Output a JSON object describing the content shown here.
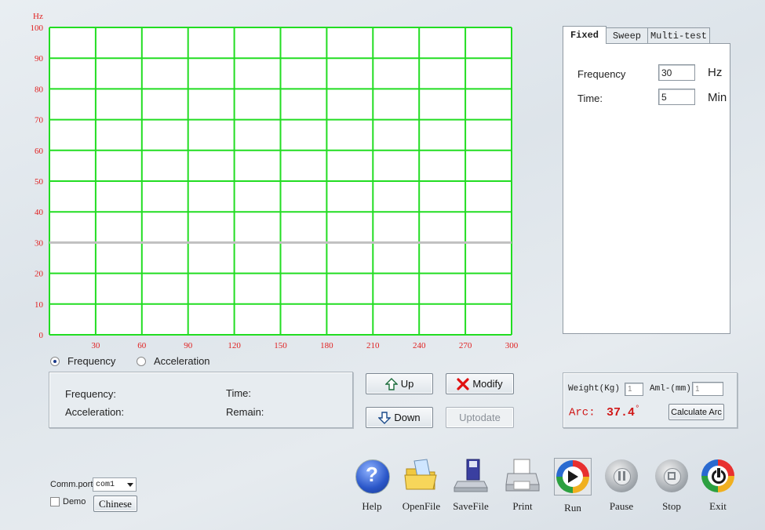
{
  "chart_data": {
    "type": "line",
    "y_unit": "Hz",
    "ylim": [
      0,
      100
    ],
    "xlim": [
      0,
      300
    ],
    "y_ticks": [
      0,
      10,
      20,
      30,
      40,
      50,
      60,
      70,
      80,
      90,
      100
    ],
    "x_ticks": [
      30,
      60,
      90,
      120,
      150,
      180,
      210,
      240,
      270,
      300
    ],
    "grid": true,
    "grid_color": "#22dd22",
    "series": [
      {
        "x": [
          0,
          300
        ],
        "y": [
          30,
          30
        ],
        "color": "#c0c0c0"
      }
    ]
  },
  "mode": {
    "frequency_label": "Frequency",
    "acceleration_label": "Acceleration",
    "selected": "Frequency"
  },
  "status": {
    "frequency_label": "Frequency:",
    "acceleration_label": "Acceleration:",
    "time_label": "Time:",
    "remain_label": "Remain:"
  },
  "buttons": {
    "up": "Up",
    "down": "Down",
    "modify": "Modify",
    "uptodate": "Uptodate"
  },
  "tabs": [
    {
      "label": "Fixed"
    },
    {
      "label": "Sweep"
    },
    {
      "label": "Multi-test"
    }
  ],
  "fixed": {
    "frequency_label": "Frequency",
    "frequency_value": "30",
    "frequency_unit": "Hz",
    "time_label": "Time:",
    "time_value": "5",
    "time_unit": "Min"
  },
  "arc": {
    "weight_label": "Weight(Kg)",
    "weight_value": "1",
    "aml_label": "Aml-(mm)",
    "aml_value": "1",
    "arc_label": "Arc:",
    "arc_value": "37.4",
    "arc_unit": "°",
    "calc_button": "Calculate Arc"
  },
  "comm": {
    "port_label": "Comm.port",
    "port_value": "com1",
    "demo_label": "Demo",
    "chinese_button": "Chinese"
  },
  "toolbar": [
    {
      "label": "Help",
      "icon": "help-icon"
    },
    {
      "label": "OpenFile",
      "icon": "folder-icon"
    },
    {
      "label": "SaveFile",
      "icon": "save-icon"
    },
    {
      "label": "Print",
      "icon": "printer-icon"
    },
    {
      "label": "Run",
      "icon": "play-icon"
    },
    {
      "label": "Pause",
      "icon": "pause-icon"
    },
    {
      "label": "Stop",
      "icon": "stop-icon"
    },
    {
      "label": "Exit",
      "icon": "power-icon"
    }
  ],
  "colors": {
    "axis_labels": "#e02020",
    "arc_text": "#d01818"
  }
}
